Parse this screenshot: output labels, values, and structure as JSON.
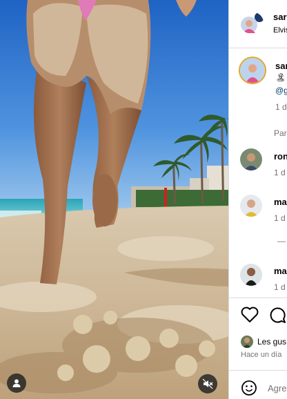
{
  "post": {
    "author_username": "sari",
    "author_subtitle": "Elvis"
  },
  "caption": {
    "username": "sari",
    "line1_emoji": "🏝",
    "line2_mention": "@g",
    "time": "1 d"
  },
  "translation_link": "Par",
  "comments": [
    {
      "username": "ron",
      "time": "1 d"
    },
    {
      "username": "ma",
      "time": "1 d"
    },
    {
      "username": "ma",
      "time": "1 d"
    }
  ],
  "reply_divider": "—",
  "likes_text": "Les gus",
  "post_time": "Hace un día",
  "comment_placeholder": "Agre",
  "icons": {
    "tag": "person-icon",
    "mute": "speaker-muted-icon",
    "like": "heart-icon",
    "comment": "speech-bubble-icon",
    "emoji": "smiley-icon"
  }
}
